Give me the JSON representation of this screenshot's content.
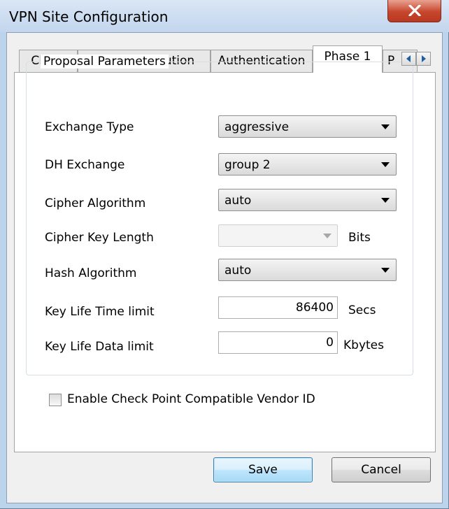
{
  "window": {
    "title": "VPN Site Configuration"
  },
  "tabs": [
    {
      "label": "Client",
      "active": false
    },
    {
      "label": "Name Resolution",
      "active": false
    },
    {
      "label": "Authentication",
      "active": false
    },
    {
      "label": "Phase 1",
      "active": true
    },
    {
      "label": "P",
      "active": false
    }
  ],
  "tab_scroll": {
    "left_icon": "arrow-left-icon",
    "right_icon": "arrow-right-icon"
  },
  "group": {
    "label": "Proposal Parameters"
  },
  "fields": {
    "exchange_type": {
      "label": "Exchange Type",
      "value": "aggressive"
    },
    "dh_exchange": {
      "label": "DH Exchange",
      "value": "group 2"
    },
    "cipher_algorithm": {
      "label": "Cipher Algorithm",
      "value": "auto"
    },
    "cipher_key_length": {
      "label": "Cipher Key Length",
      "value": "",
      "unit": "Bits",
      "disabled": true
    },
    "hash_algorithm": {
      "label": "Hash Algorithm",
      "value": "auto"
    },
    "key_life_time": {
      "label": "Key Life Time limit",
      "value": "86400",
      "unit": "Secs"
    },
    "key_life_data": {
      "label": "Key Life Data limit",
      "value": "0",
      "unit": "Kbytes"
    }
  },
  "checkbox": {
    "label": "Enable Check Point Compatible Vendor ID",
    "checked": false
  },
  "buttons": {
    "save": "Save",
    "cancel": "Cancel"
  },
  "colors": {
    "close_button": "#c7462c",
    "title_bar": "#c3d6ed",
    "default_button_border": "#3c7fb1"
  }
}
